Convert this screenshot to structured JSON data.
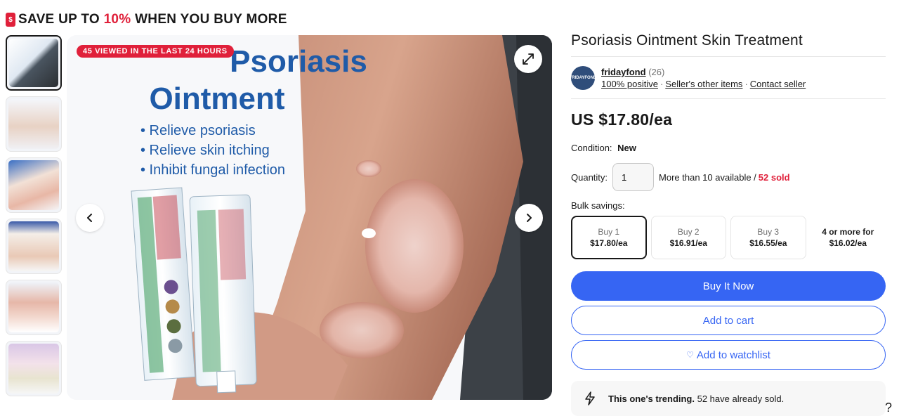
{
  "banner": {
    "prefix": "SAVE UP TO ",
    "accent": "10%",
    "suffix": " WHEN YOU BUY MORE"
  },
  "gallery": {
    "badge": "45 VIEWED IN THE LAST 24 HOURS",
    "thumb_count": 6
  },
  "product": {
    "title": "Psoriasis Ointment Skin Treatment",
    "price": "US $17.80/ea",
    "condition_label": "Condition:",
    "condition_value": "New",
    "quantity_label": "Quantity:",
    "quantity_value": "1",
    "availability": "More than 10 available / ",
    "sold": "52 sold"
  },
  "seller": {
    "name": "fridayfond",
    "count": "(26)",
    "positive": "100% positive",
    "other_items": "Seller's other items",
    "contact": "Contact seller"
  },
  "bulk": {
    "label": "Bulk savings:",
    "options": [
      {
        "qty": "Buy 1",
        "price": "$17.80/ea"
      },
      {
        "qty": "Buy 2",
        "price": "$16.91/ea"
      },
      {
        "qty": "Buy 3",
        "price": "$16.55/ea"
      },
      {
        "qty": "4 or more for",
        "price": "$16.02/ea"
      }
    ]
  },
  "actions": {
    "buy_now": "Buy It Now",
    "add_cart": "Add to cart",
    "watchlist": "Add to watchlist"
  },
  "trend": {
    "bold": "This one's trending.",
    "rest": " 52 have already sold."
  },
  "colors": {
    "accent_red": "#e0203a",
    "ebay_blue": "#3665f3"
  }
}
